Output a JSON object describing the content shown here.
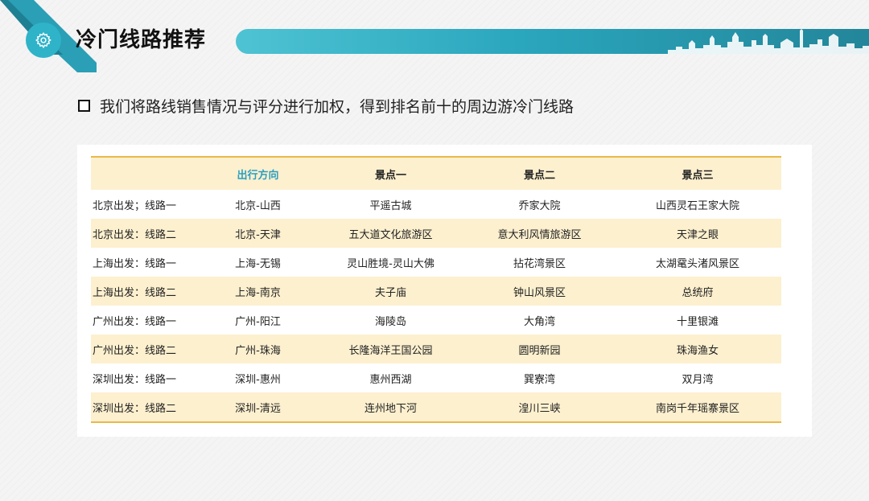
{
  "header": {
    "title": "冷门线路推荐",
    "accent_color": "#2fb3c9",
    "icon": "gear-icon"
  },
  "bullet": {
    "text": "我们将路线销售情况与评分进行加权，得到排名前十的周边游冷门线路"
  },
  "table": {
    "headers": [
      "",
      "出行方向",
      "景点一",
      "景点二",
      "景点三"
    ],
    "rows": [
      [
        "北京出发；线路一",
        "北京-山西",
        "平遥古城",
        "乔家大院",
        "山西灵石王家大院"
      ],
      [
        "北京出发：线路二",
        "北京-天津",
        "五大道文化旅游区",
        "意大利风情旅游区",
        "天津之眼"
      ],
      [
        "上海出发：线路一",
        "上海-无锡",
        "灵山胜境-灵山大佛",
        "拈花湾景区",
        "太湖鼋头渚风景区"
      ],
      [
        "上海出发：线路二",
        "上海-南京",
        "夫子庙",
        "钟山风景区",
        "总统府"
      ],
      [
        "广州出发：线路一",
        "广州-阳江",
        "海陵岛",
        "大角湾",
        "十里银滩"
      ],
      [
        "广州出发：线路二",
        "广州-珠海",
        "长隆海洋王国公园",
        "圆明新园",
        "珠海渔女"
      ],
      [
        "深圳出发：线路一",
        "深圳-惠州",
        "惠州西湖",
        "巽寮湾",
        "双月湾"
      ],
      [
        "深圳出发：线路二",
        "深圳-清远",
        "连州地下河",
        "湟川三峡",
        "南岗千年瑶寨景区"
      ]
    ]
  }
}
